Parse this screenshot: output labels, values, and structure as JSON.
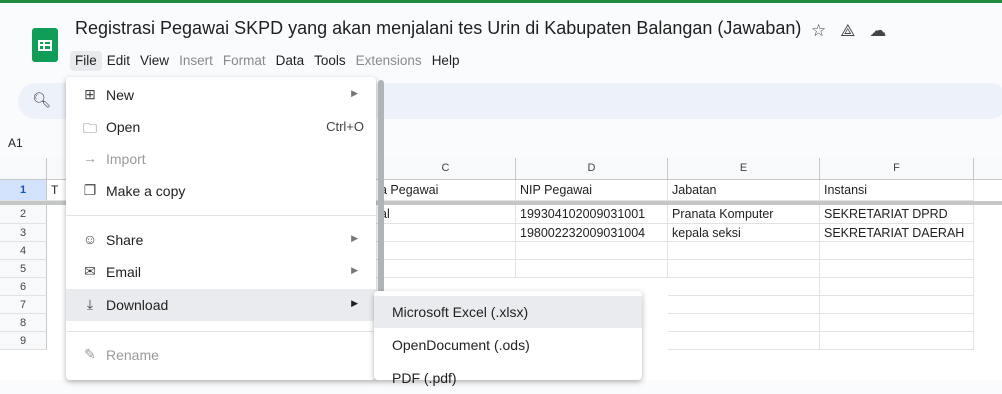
{
  "doc": {
    "title": "Registrasi Pegawai SKPD yang akan menjalani tes Urin di Kabupaten Balangan (Jawaban)"
  },
  "title_icons": [
    "☆",
    "⟁",
    "☁"
  ],
  "menubar": [
    "File",
    "Edit",
    "View",
    "Insert",
    "Format",
    "Data",
    "Tools",
    "Extensions",
    "Help"
  ],
  "namebox": "A1",
  "columns": [
    "C",
    "D",
    "E",
    "F"
  ],
  "rows": [
    "1",
    "2",
    "3",
    "4",
    "5",
    "6",
    "7",
    "8",
    "9"
  ],
  "partial_cells": {
    "b1": "T"
  },
  "header_row": [
    "a Pegawai",
    "NIP Pegawai",
    "Jabatan",
    "Instansi"
  ],
  "data_rows": [
    [
      "al",
      "19930410200903100​1",
      "Pranata Komputer",
      "SEKRETARIAT DPRD"
    ],
    [
      "",
      "19800223200903100​4",
      "kepala seksi",
      "SEKRETARIAT DAERAH"
    ]
  ],
  "file_menu": {
    "new": "New",
    "open": "Open",
    "open_shortcut": "Ctrl+O",
    "import": "Import",
    "make_copy": "Make a copy",
    "share": "Share",
    "email": "Email",
    "download": "Download",
    "rename": "Rename"
  },
  "download_submenu": [
    "Microsoft Excel (.xlsx)",
    "OpenDocument (.ods)",
    "PDF (.pdf)"
  ]
}
